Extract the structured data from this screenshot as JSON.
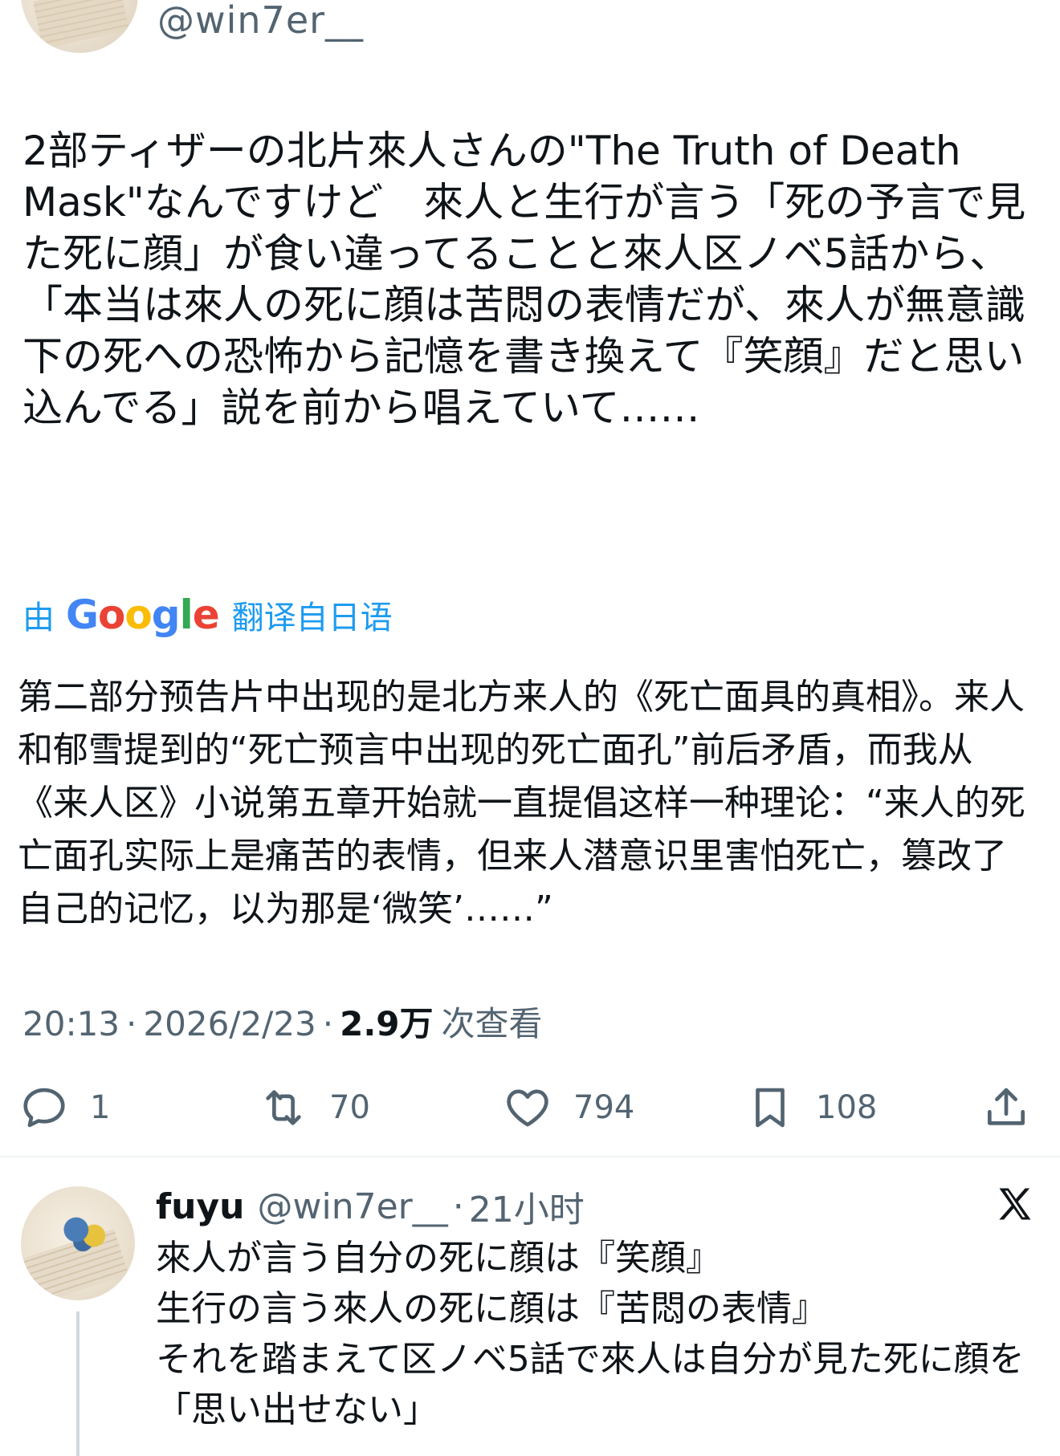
{
  "author": {
    "handle": "@win7er__"
  },
  "tweet": {
    "text": "2部ティザーの北片來人さんの\"The Truth of Death Mask\"なんですけど　來人と生行が言う「死の予言で見た死に顔」が食い違ってることと來人区ノベ5話から、「本当は來人の死に顔は苦悶の表情だが、來人が無意識下の死への恐怖から記憶を書き換えて『笑顔』だと思い込んでる」説を前から唱えていて……",
    "translate_by": "由",
    "translate_brand": [
      "G",
      "o",
      "o",
      "g",
      "l",
      "e"
    ],
    "translate_suffix": "翻译自日语",
    "translated_text": "第二部分预告片中出现的是北方来人的《死亡面具的真相》。来人和郁雪提到的“死亡预言中出现的死亡面孔”前后矛盾，而我从《来人区》小说第五章开始就一直提倡这样一种理论：“来人的死亡面孔实际上是痛苦的表情，但来人潜意识里害怕死亡，篡改了自己的记忆，以为那是‘微笑’……”",
    "time": "20:13",
    "date": "2026/2/23",
    "separator": "·",
    "views_count": "2.9万",
    "views_label": "次查看"
  },
  "actions": {
    "reply_count": "1",
    "retweet_count": "70",
    "like_count": "794",
    "bookmark_count": "108"
  },
  "reply": {
    "name": "fuyu",
    "handle": "@win7er__",
    "separator": "·",
    "time": "21小时",
    "text": "來人が言う自分の死に顔は『笑顔』\n生行の言う來人の死に顔は『苦悶の表情』\nそれを踏まえて区ノベ5話で來人は自分が見た死に顔を「思い出せない」"
  },
  "colors": {
    "accent": "#1d9bf0",
    "secondary_text": "#536471",
    "primary_text": "#0f1419",
    "google_blue": "#4285f4",
    "google_red": "#ea4335",
    "google_yellow": "#fbbc05",
    "google_green": "#34a853"
  },
  "icons": [
    "reply-icon",
    "retweet-icon",
    "like-icon",
    "bookmark-icon",
    "share-icon",
    "x-logo-icon"
  ]
}
